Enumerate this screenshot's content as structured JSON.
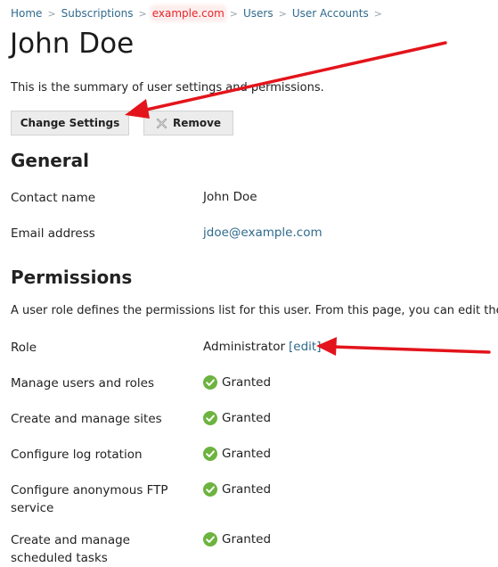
{
  "breadcrumb": {
    "items": [
      "Home",
      "Subscriptions",
      "example.com",
      "Users",
      "User Accounts"
    ],
    "separator": ">"
  },
  "page": {
    "title": "John Doe",
    "summary": "This is the summary of user settings and permissions."
  },
  "toolbar": {
    "change_label": "Change Settings",
    "remove_label": "Remove"
  },
  "general": {
    "title": "General",
    "contact_name_label": "Contact name",
    "contact_name_value": "John Doe",
    "email_label": "Email address",
    "email_value": "jdoe@example.com"
  },
  "permissions": {
    "title": "Permissions",
    "description": "A user role defines the permissions list for this user. From this page, you can edit the",
    "role_label": "Role",
    "role_value": "Administrator",
    "role_edit": "[edit]",
    "items": [
      {
        "label": "Manage users and roles",
        "value": "Granted"
      },
      {
        "label": "Create and manage sites",
        "value": "Granted"
      },
      {
        "label": "Configure log rotation",
        "value": "Granted"
      },
      {
        "label": "Configure anonymous FTP service",
        "value": "Granted"
      },
      {
        "label": "Create and manage scheduled tasks",
        "value": "Granted"
      }
    ]
  },
  "colors": {
    "link": "#2f6a8c",
    "highlight": "#e8262a",
    "granted": "#6cb33f",
    "annotation_arrow": "#e3141b"
  }
}
